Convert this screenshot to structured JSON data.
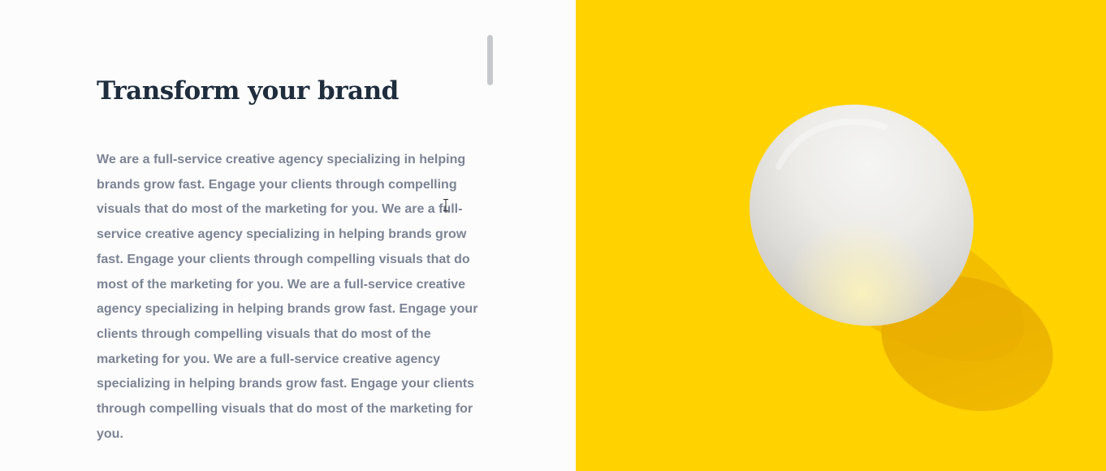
{
  "hero": {
    "headline": "Transform your brand",
    "paragraph": "We are a full-service creative agency specializing in helping brands grow fast. Engage your clients through compelling visuals that do most of the marketing for you. We are a full-service creative agency specializing in helping brands grow fast. Engage your clients through compelling visuals that do most of the marketing for you. We are a full-service creative agency specializing in helping brands grow fast. Engage your clients through compelling visuals that do most of the marketing for you. We are a full-service creative agency specializing in helping brands grow fast. Engage your clients through compelling visuals that do most of the marketing for you."
  },
  "image": {
    "subject": "white egg on yellow background",
    "background_color": "#ffd200"
  },
  "colors": {
    "headline": "#1f2d3d",
    "body": "#7c8494",
    "scrollbar": "#c6c8cc"
  },
  "icons": {
    "cursor": "text-cursor-icon"
  }
}
